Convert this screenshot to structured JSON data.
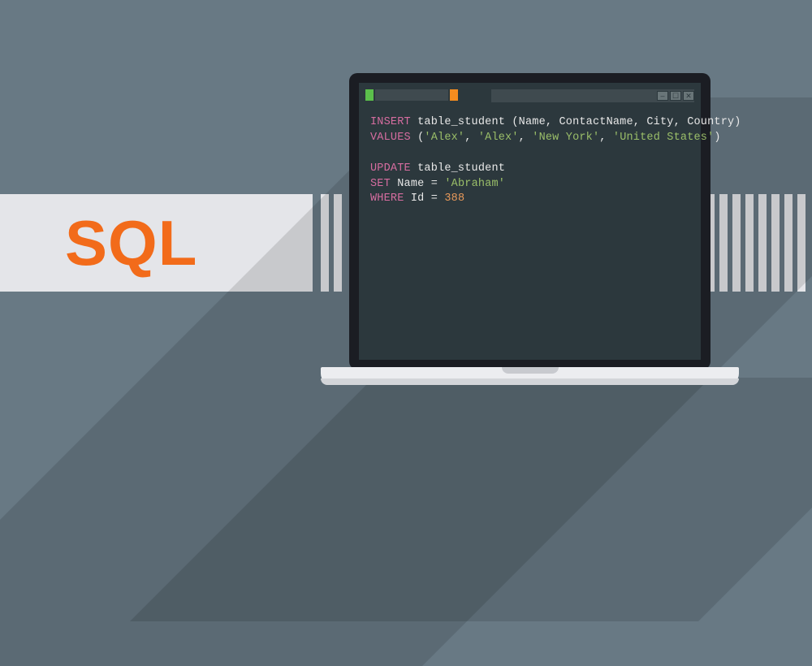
{
  "label": "SQL",
  "windowControls": {
    "minimize": "–",
    "maximize": "☐",
    "close": "✕"
  },
  "code": {
    "line1": {
      "kw1": "INSERT",
      "table": "table_student",
      "cols": "(Name, ContactName, City, Country)"
    },
    "line2": {
      "kw": "VALUES",
      "v1": "'Alex'",
      "v2": "'Alex'",
      "v3": "'New York'",
      "v4": "'United States'"
    },
    "line3": {
      "kw": "UPDATE",
      "table": "table_student"
    },
    "line4": {
      "kw": "SET",
      "col": "Name",
      "eq": "=",
      "val": "'Abraham'"
    },
    "line5": {
      "kw": "WHERE",
      "col": "Id",
      "eq": "=",
      "val": "388"
    }
  }
}
